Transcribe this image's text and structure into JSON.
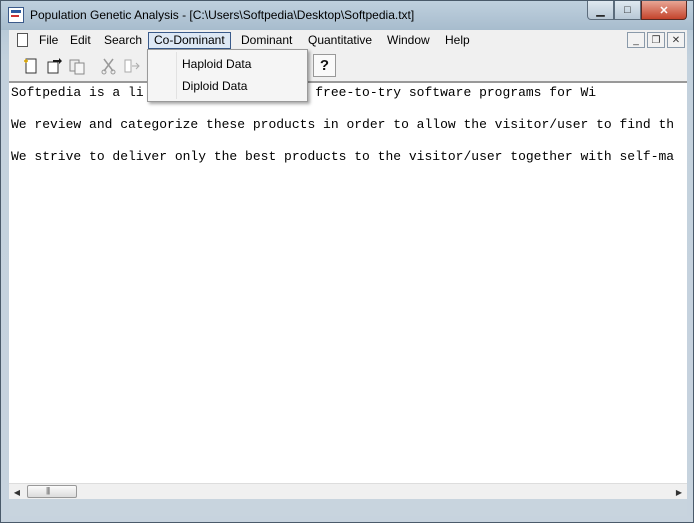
{
  "window": {
    "title": "Population Genetic Analysis - [C:\\Users\\Softpedia\\Desktop\\Softpedia.txt]",
    "caption_buttons": {
      "minimize": "▁",
      "maximize": "□",
      "close": "✕"
    }
  },
  "menubar": {
    "items": [
      "File",
      "Edit",
      "Search",
      "Co-Dominant",
      "Dominant",
      "Quantitative",
      "Window",
      "Help"
    ],
    "active": "Co-Dominant",
    "mdi_buttons": {
      "minimize": "_",
      "restore": "❐",
      "close": "✕"
    }
  },
  "toolbar": {
    "buttons": [
      "new-icon",
      "open-icon",
      "save-icon",
      "cut-icon",
      "copy-icon",
      "paste-icon",
      "help-icon"
    ],
    "help_label": "?"
  },
  "dropdown": {
    "items": [
      "Haploid Data",
      "Diploid Data"
    ]
  },
  "document": {
    "lines": [
      "Softpedia is a li           0 free and free-to-try software programs for Wi",
      "We review and categorize these products in order to allow the visitor/user to find th",
      "We strive to deliver only the best products to the visitor/user together with self-ma"
    ]
  }
}
